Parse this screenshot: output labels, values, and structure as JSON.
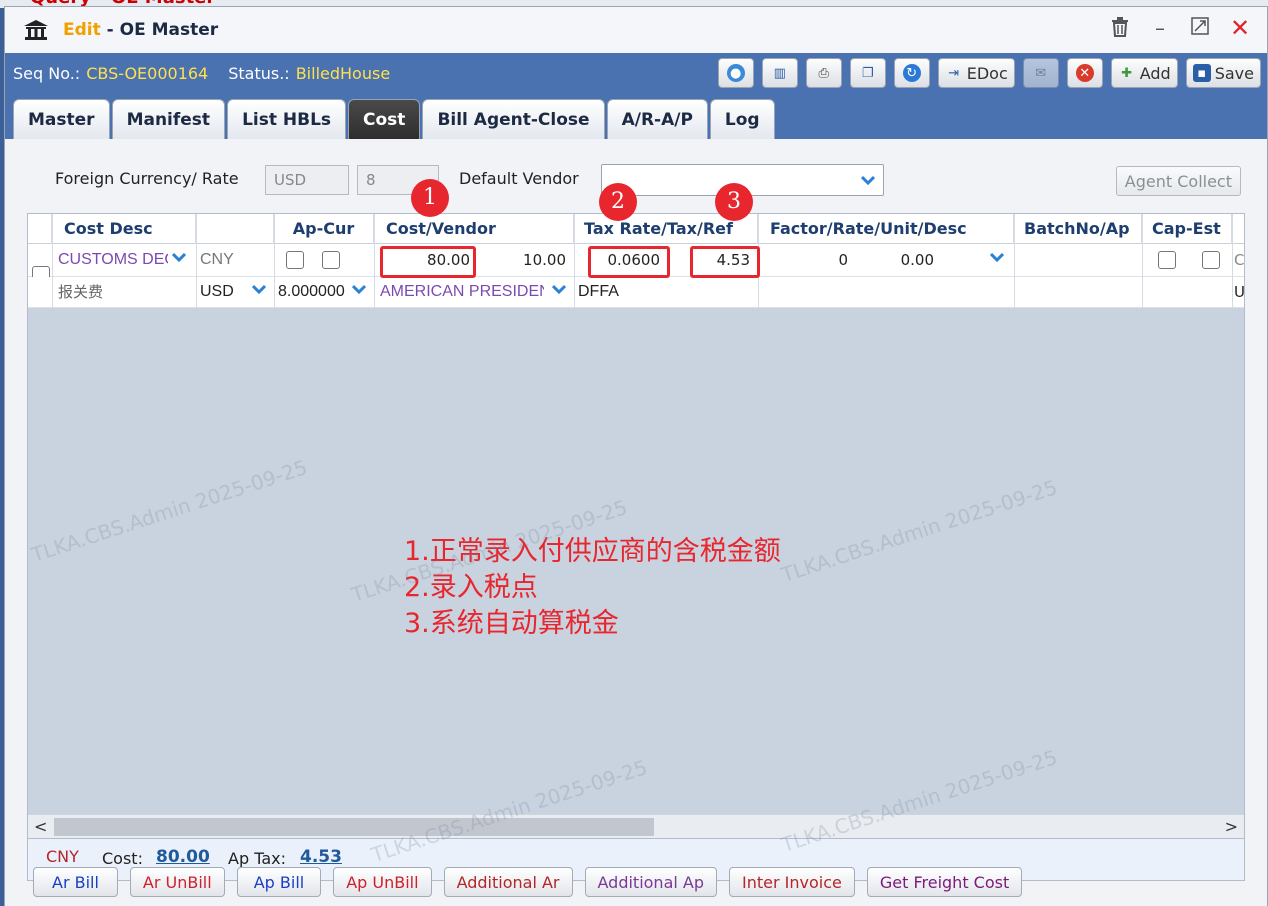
{
  "top_strip_text": "Query - OE Master",
  "window": {
    "title_prefix": "Edit",
    "title_sep": " - ",
    "title": "OE Master"
  },
  "seq": {
    "seq_label": "Seq No.:",
    "seq_value": "CBS-OE000164",
    "status_label": "Status.:",
    "status_value": "BilledHouse"
  },
  "toolbar": {
    "edoc_label": "EDoc",
    "add_label": "Add",
    "save_label": "Save"
  },
  "tabs": [
    {
      "label": "Master"
    },
    {
      "label": "Manifest"
    },
    {
      "label": "List HBLs"
    },
    {
      "label": "Cost"
    },
    {
      "label": "Bill Agent-Close"
    },
    {
      "label": "A/R-A/P"
    },
    {
      "label": "Log"
    }
  ],
  "form": {
    "foreign_currency_label": "Foreign Currency/ Rate",
    "currency_value": "USD",
    "rate_value": "8",
    "default_vendor_label": "Default Vendor",
    "default_vendor_value": "",
    "agent_collect_label": "Agent Collect"
  },
  "grid": {
    "headers": [
      "Cost Desc",
      "Ap-Cur",
      "Cost/Vendor",
      "Tax Rate/Tax/Ref",
      "Factor/Rate/Unit/Desc",
      "BatchNo/Ap",
      "Cap-Est"
    ],
    "row1": {
      "cost_desc": "CUSTOMS DEC",
      "ap_cur": "CNY",
      "cost": "80.00",
      "vendor_amt": "10.00",
      "tax_rate": "0.0600",
      "tax": "4.53",
      "factor": "0",
      "rate": "0.00",
      "cut_text": "C"
    },
    "row2": {
      "desc_cn": "报关费",
      "currency": "USD",
      "rate": "8.000000",
      "vendor": "AMERICAN PRESIDEN",
      "ref": "DFFA",
      "cut_text": "U"
    }
  },
  "badges": [
    "1",
    "2",
    "3"
  ],
  "annotation": [
    "1.正常录入付供应商的含税金额",
    "2.录入税点",
    "3.系统自动算税金"
  ],
  "footer": {
    "currency": "CNY",
    "cost_label": "Cost:",
    "cost_value": "80.00",
    "ap_tax_label": "Ap Tax:",
    "ap_tax_value": "4.53"
  },
  "bottom_buttons": [
    {
      "label": "Ar Bill",
      "color": "#1a3fc4"
    },
    {
      "label": "Ar UnBill",
      "color": "#d0202a"
    },
    {
      "label": "Ap Bill",
      "color": "#1a3fc4"
    },
    {
      "label": "Ap UnBill",
      "color": "#d0202a"
    },
    {
      "label": "Additional Ar",
      "color": "#b3262a"
    },
    {
      "label": "Additional Ap",
      "color": "#7a3a96"
    },
    {
      "label": "Inter Invoice",
      "color": "#b3262a"
    },
    {
      "label": "Get Freight Cost",
      "color": "#7a1a7a"
    }
  ],
  "watermark": "TLKA.CBS.Admin 2025-09-25",
  "colors": {
    "accent_blue": "#4a72b0",
    "highlight_red": "#e8262e",
    "seq_yellow": "#ffe04d"
  }
}
